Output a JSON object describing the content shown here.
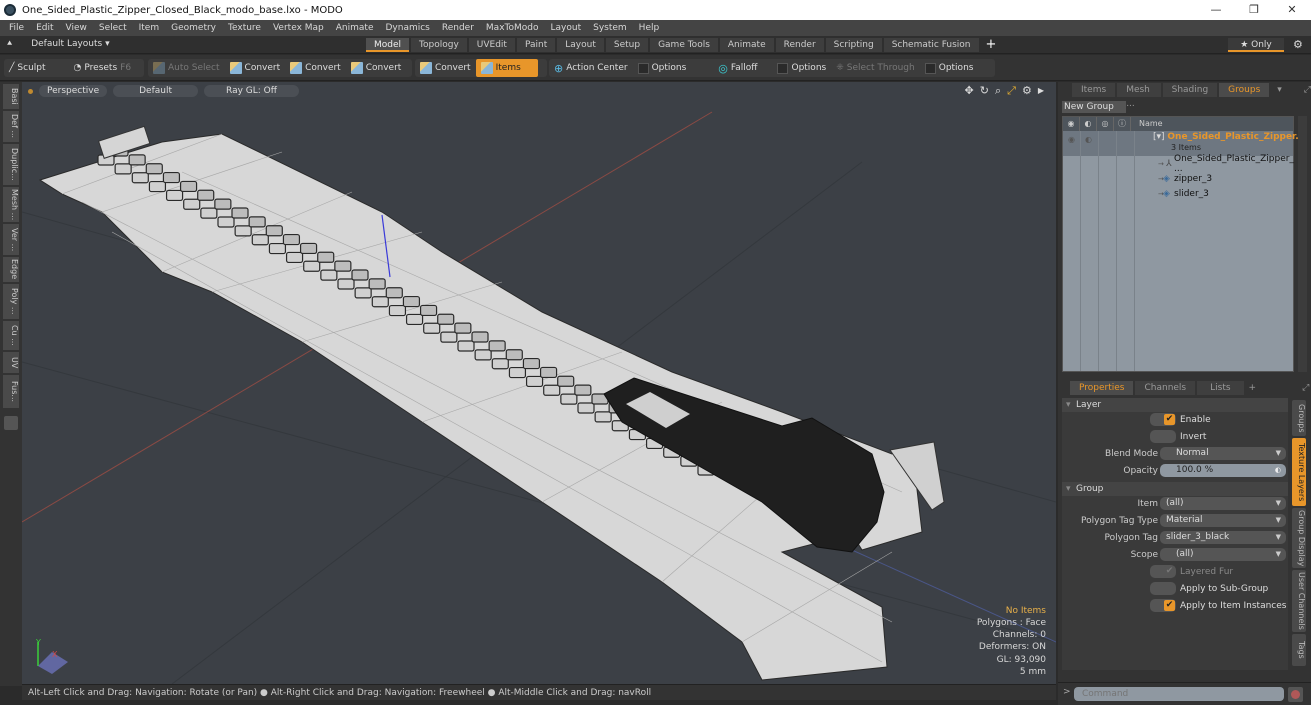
{
  "window": {
    "title": "One_Sided_Plastic_Zipper_Closed_Black_modo_base.lxo - MODO",
    "controls": {
      "minimize": "—",
      "maximize": "❐",
      "close": "✕"
    }
  },
  "menu": [
    "File",
    "Edit",
    "View",
    "Select",
    "Item",
    "Geometry",
    "Texture",
    "Vertex Map",
    "Animate",
    "Dynamics",
    "Render",
    "MaxToModo",
    "Layout",
    "System",
    "Help"
  ],
  "layoutbar": {
    "layouts_label": "Default Layouts ▾",
    "tabs": [
      {
        "label": "Model",
        "active": true
      },
      {
        "label": "Topology"
      },
      {
        "label": "UVEdit"
      },
      {
        "label": "Paint"
      },
      {
        "label": "Layout"
      },
      {
        "label": "Setup"
      },
      {
        "label": "Game Tools"
      },
      {
        "label": "Animate"
      },
      {
        "label": "Render"
      },
      {
        "label": "Scripting"
      },
      {
        "label": "Schematic Fusion"
      }
    ],
    "add_tab": "+",
    "only_label": "★ Only"
  },
  "toolbar": {
    "sculpt": "Sculpt",
    "presets": "Presets",
    "presets_key": "F6",
    "auto_select": "Auto Select",
    "convert1": "Convert",
    "convert2": "Convert",
    "convert3": "Convert",
    "convert4": "Convert",
    "items": "Items",
    "action_center": "Action Center",
    "options1": "Options",
    "falloff": "Falloff",
    "options2": "Options",
    "select_through": "Select Through",
    "options3": "Options"
  },
  "left_tabs": [
    "Basi",
    "Def ...",
    "Duplic...",
    "Mesh ...",
    "Ver ...",
    "Edge",
    "Poly ...",
    "Cu ...",
    "UV",
    "Fus..."
  ],
  "viewport": {
    "view_mode": "Perspective",
    "shading": "Default",
    "raygl": "Ray GL: Off",
    "hud": {
      "selection": "No Items",
      "polygons": "Polygons : Face",
      "channels": "Channels: 0",
      "deformers": "Deformers: ON",
      "gl": "GL: 93,090",
      "unit": "5 mm"
    },
    "axis_labels": {
      "y": "Y",
      "x": "X"
    }
  },
  "statusbar": "Alt-Left Click and Drag: Navigation: Rotate (or Pan) ● Alt-Right Click and Drag: Navigation: Freewheel ● Alt-Middle Click and Drag: navRoll",
  "groups_panel": {
    "tabs": [
      {
        "label": "Items"
      },
      {
        "label": "Mesh ..."
      },
      {
        "label": "Shading"
      },
      {
        "label": "Groups",
        "active": true
      }
    ],
    "new_group": "New Group",
    "name_header": "Name",
    "group": {
      "name": "One_Sided_Plastic_Zipper...",
      "count": "3 Items"
    },
    "children": [
      "One_Sided_Plastic_Zipper_ ...",
      "zipper_3",
      "slider_3"
    ]
  },
  "properties_panel": {
    "tabs": [
      {
        "label": "Properties",
        "active": true
      },
      {
        "label": "Channels"
      },
      {
        "label": "Lists"
      }
    ],
    "layer_section": "Layer",
    "enable": {
      "label": "Enable",
      "checked": true
    },
    "invert": {
      "label": "Invert",
      "checked": false
    },
    "blend_mode": {
      "label": "Blend Mode",
      "value": "Normal"
    },
    "opacity": {
      "label": "Opacity",
      "value": "100.0 %"
    },
    "group_section": "Group",
    "item": {
      "label": "Item",
      "value": "(all)"
    },
    "polygon_tag_type": {
      "label": "Polygon Tag Type",
      "value": "Material"
    },
    "polygon_tag": {
      "label": "Polygon Tag",
      "value": "slider_3_black"
    },
    "scope": {
      "label": "Scope",
      "value": "(all)"
    },
    "layered_fur": {
      "label": "Layered Fur",
      "checked": true,
      "disabled": true
    },
    "apply_sub_group": {
      "label": "Apply to Sub-Group",
      "checked": false
    },
    "apply_instances": {
      "label": "Apply to Item Instances",
      "checked": true
    },
    "side_tabs": [
      {
        "label": "Groups"
      },
      {
        "label": "Texture Layers",
        "active": true
      },
      {
        "label": "Group Display"
      },
      {
        "label": "User Channels"
      },
      {
        "label": "Tags"
      }
    ]
  },
  "command": {
    "placeholder": "Command"
  },
  "colors": {
    "accent": "#e8962a",
    "viewport_bg": "#3c4046",
    "panel_bg": "#333333",
    "list_bg": "#8f98a1"
  }
}
